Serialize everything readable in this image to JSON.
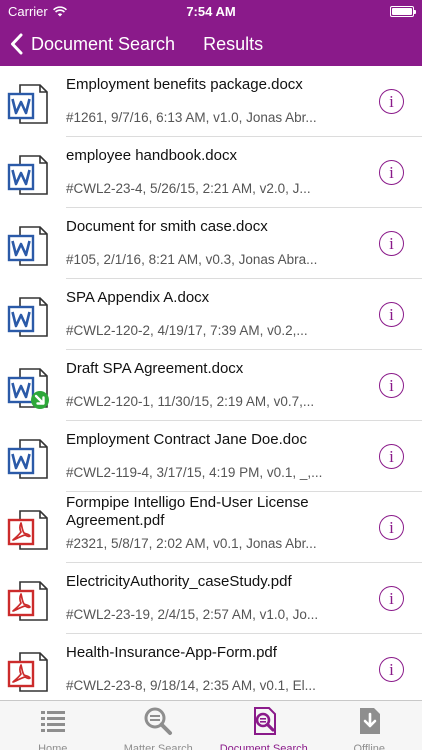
{
  "status": {
    "carrier": "Carrier",
    "time": "7:54 AM",
    "battery_level": 1.0
  },
  "nav": {
    "back_label": "Document Search",
    "title": "Results"
  },
  "colors": {
    "accent": "#8a1a8a",
    "word_blue": "#2b5aa8",
    "pdf_red": "#cc2b2b",
    "offline_green": "#2ea83a"
  },
  "results": [
    {
      "title": "Employment benefits package.docx",
      "meta": "#1261, 9/7/16, 6:13 AM,  v1.0,  Jonas Abr...",
      "icon": "word-doc-icon"
    },
    {
      "title": "employee handbook.docx",
      "meta": "#CWL2-23-4, 5/26/15, 2:21 AM,  v2.0,  J...",
      "icon": "word-doc-icon"
    },
    {
      "title": "Document for smith case.docx",
      "meta": "#105, 2/1/16, 8:21 AM,  v0.3,  Jonas Abra...",
      "icon": "word-doc-icon"
    },
    {
      "title": "SPA Appendix A.docx",
      "meta": "#CWL2-120-2, 4/19/17, 7:39 AM,  v0.2,...",
      "icon": "word-doc-icon"
    },
    {
      "title": "Draft SPA Agreement.docx",
      "meta": "#CWL2-120-1, 11/30/15, 2:19 AM,  v0.7,...",
      "icon": "word-doc-offline-icon"
    },
    {
      "title": "Employment Contract Jane Doe.doc",
      "meta": "#CWL2-119-4, 3/17/15, 4:19 PM,  v0.1,  _,...",
      "icon": "word-doc-icon"
    },
    {
      "title": "Formpipe Intelligo End-User License Agreement.pdf",
      "meta": "#2321, 5/8/17, 2:02 AM,  v0.1,  Jonas Abr...",
      "icon": "pdf-doc-icon"
    },
    {
      "title": "ElectricityAuthority_caseStudy.pdf",
      "meta": "#CWL2-23-19, 2/4/15, 2:57 AM,  v1.0,  Jo...",
      "icon": "pdf-doc-icon"
    },
    {
      "title": "Health-Insurance-App-Form.pdf",
      "meta": "#CWL2-23-8, 9/18/14, 2:35 AM,  v0.1,  El...",
      "icon": "pdf-doc-icon"
    }
  ],
  "info_glyph": "i",
  "tabs": [
    {
      "label": "Home",
      "icon": "list-icon",
      "active": false
    },
    {
      "label": "Matter Search",
      "icon": "magnifier-icon",
      "active": false
    },
    {
      "label": "Document Search",
      "icon": "document-search-icon",
      "active": true
    },
    {
      "label": "Offline",
      "icon": "download-icon",
      "active": false
    }
  ]
}
